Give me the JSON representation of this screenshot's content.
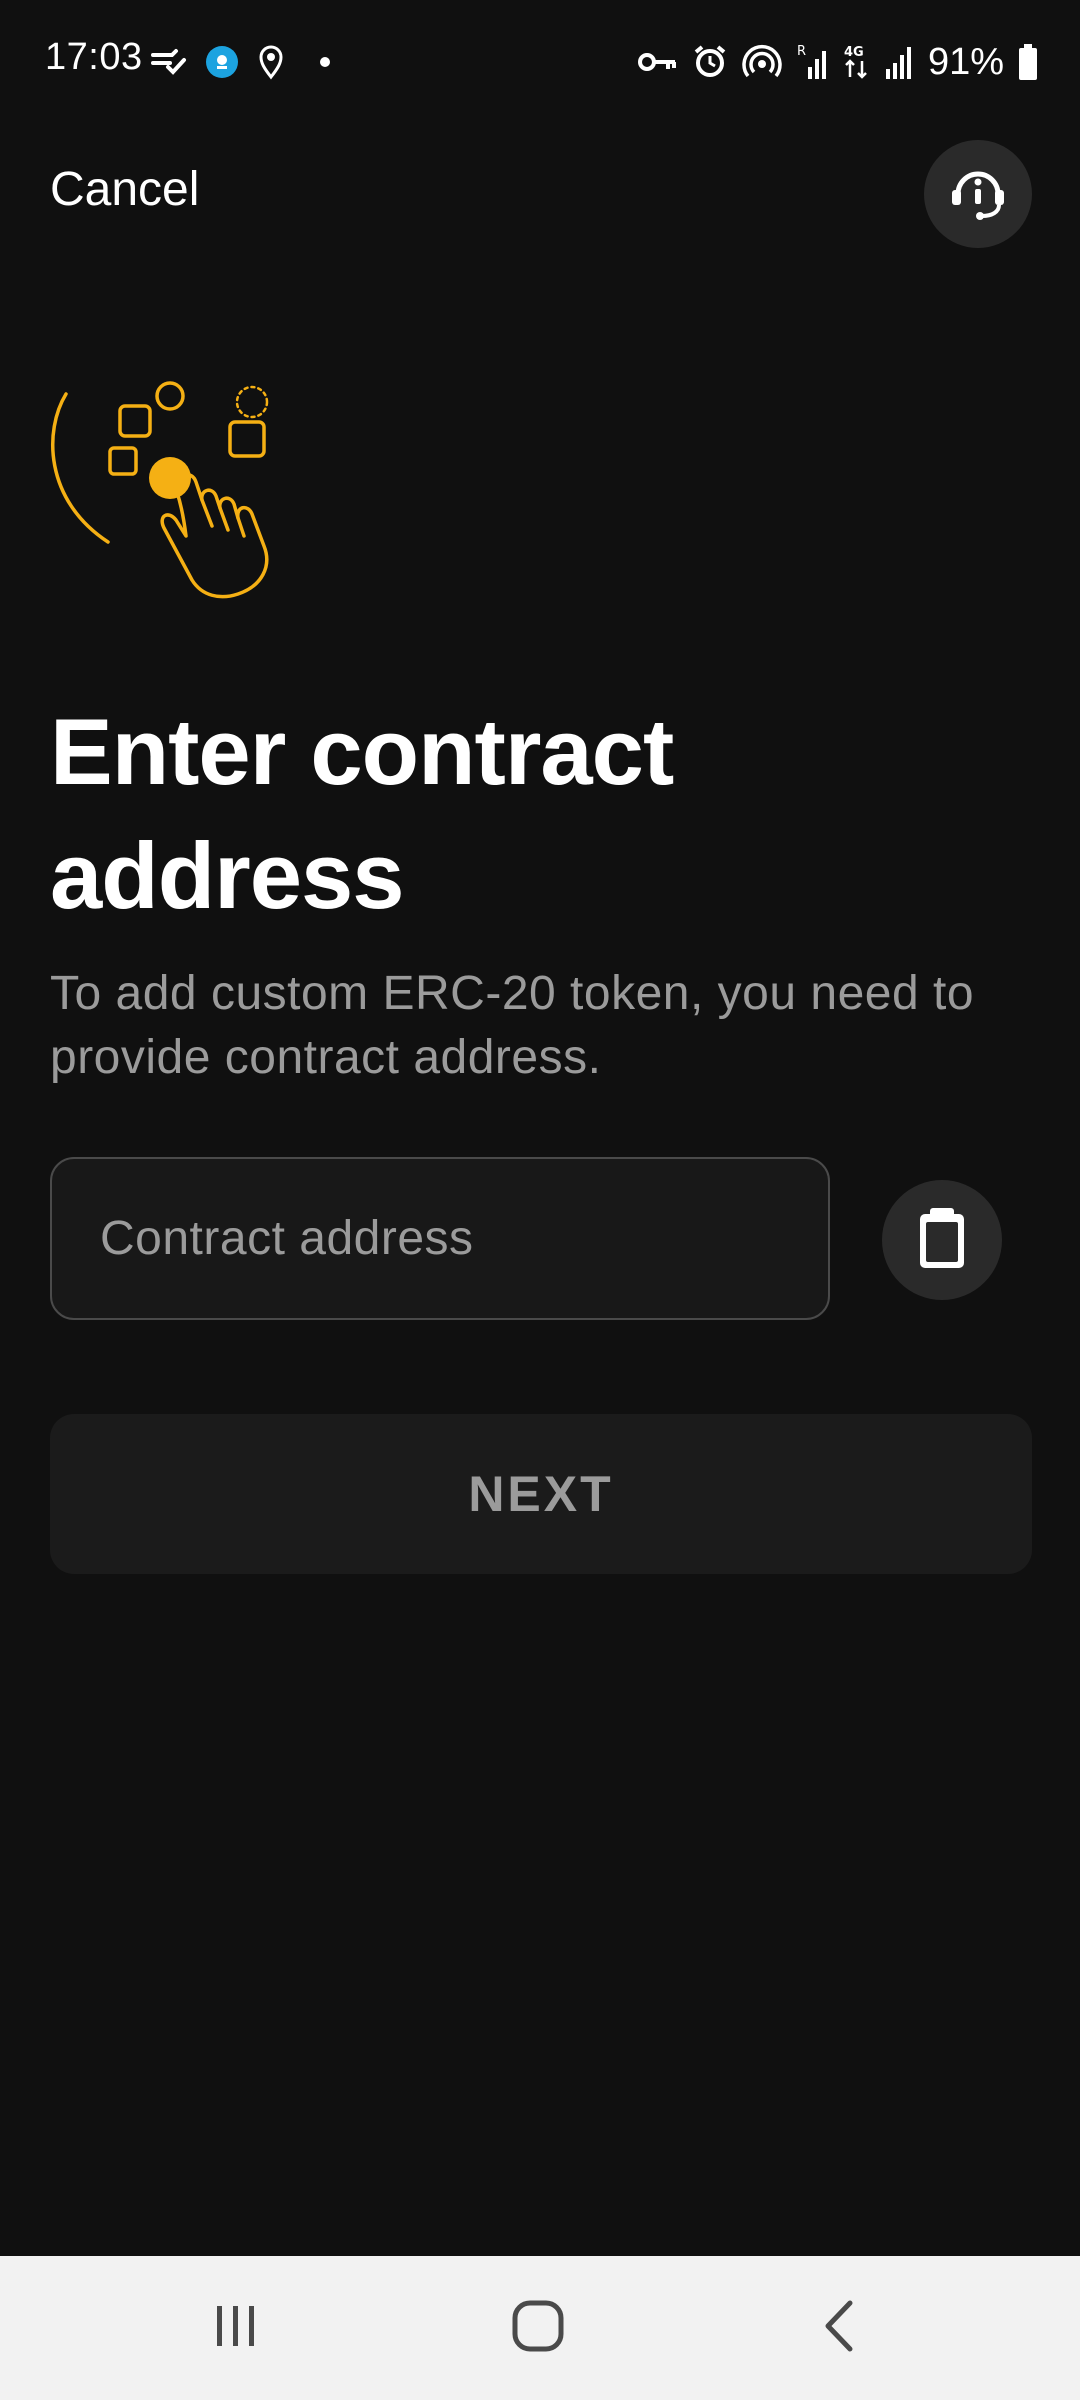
{
  "status_bar": {
    "time": "17:03",
    "battery_percent": "91%",
    "icons_left": [
      "drive-check-icon",
      "app-badge-icon",
      "location-pin-icon",
      "notification-dot-icon"
    ],
    "icons_right": [
      "vpn-key-icon",
      "alarm-icon",
      "hotspot-icon",
      "signal-roaming-icon",
      "signal-4g-icon",
      "signal-icon",
      "battery-icon"
    ]
  },
  "header": {
    "cancel_label": "Cancel",
    "support_icon": "support-headset-icon"
  },
  "illustration": {
    "name": "hand-tapping-illustration",
    "accent_color": "#F5B014"
  },
  "main": {
    "title": "Enter contract address",
    "subtitle": "To add custom ERC-20 token, you need to provide contract address.",
    "address_input": {
      "placeholder": "Contract address",
      "value": ""
    },
    "paste_icon": "clipboard-icon",
    "next_label": "NEXT"
  },
  "nav_bar": {
    "items": [
      "recents-icon",
      "home-icon",
      "back-icon"
    ]
  },
  "colors": {
    "background": "#101010",
    "surface": "#1B1B1B",
    "muted_text": "#9B9B9B",
    "accent": "#F5B014"
  }
}
